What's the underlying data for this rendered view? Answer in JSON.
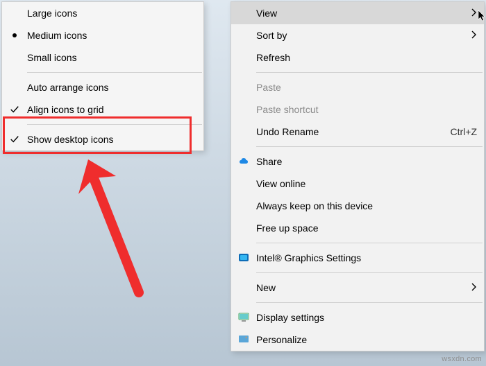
{
  "watermark": "wsxdn.com",
  "submenu": {
    "items": [
      {
        "label": "Large icons",
        "mark": ""
      },
      {
        "label": "Medium icons",
        "mark": "bullet"
      },
      {
        "label": "Small icons",
        "mark": ""
      },
      {
        "label": "Auto arrange icons",
        "mark": ""
      },
      {
        "label": "Align icons to grid",
        "mark": "check"
      },
      {
        "label": "Show desktop icons",
        "mark": "check"
      }
    ]
  },
  "mainmenu": {
    "items": [
      {
        "label": "View",
        "arrow": true,
        "hovered": true
      },
      {
        "label": "Sort by",
        "arrow": true
      },
      {
        "label": "Refresh"
      },
      {
        "label": "Paste",
        "disabled": true
      },
      {
        "label": "Paste shortcut",
        "disabled": true
      },
      {
        "label": "Undo Rename",
        "shortcut": "Ctrl+Z"
      },
      {
        "label": "Share",
        "icon": "cloud"
      },
      {
        "label": "View online"
      },
      {
        "label": "Always keep on this device"
      },
      {
        "label": "Free up space"
      },
      {
        "label": "Intel® Graphics Settings",
        "icon": "intel"
      },
      {
        "label": "New",
        "arrow": true
      },
      {
        "label": "Display settings",
        "icon": "display"
      },
      {
        "label": "Personalize",
        "icon": "personalize"
      }
    ]
  },
  "highlight": {
    "color": "#ef2d2d"
  }
}
